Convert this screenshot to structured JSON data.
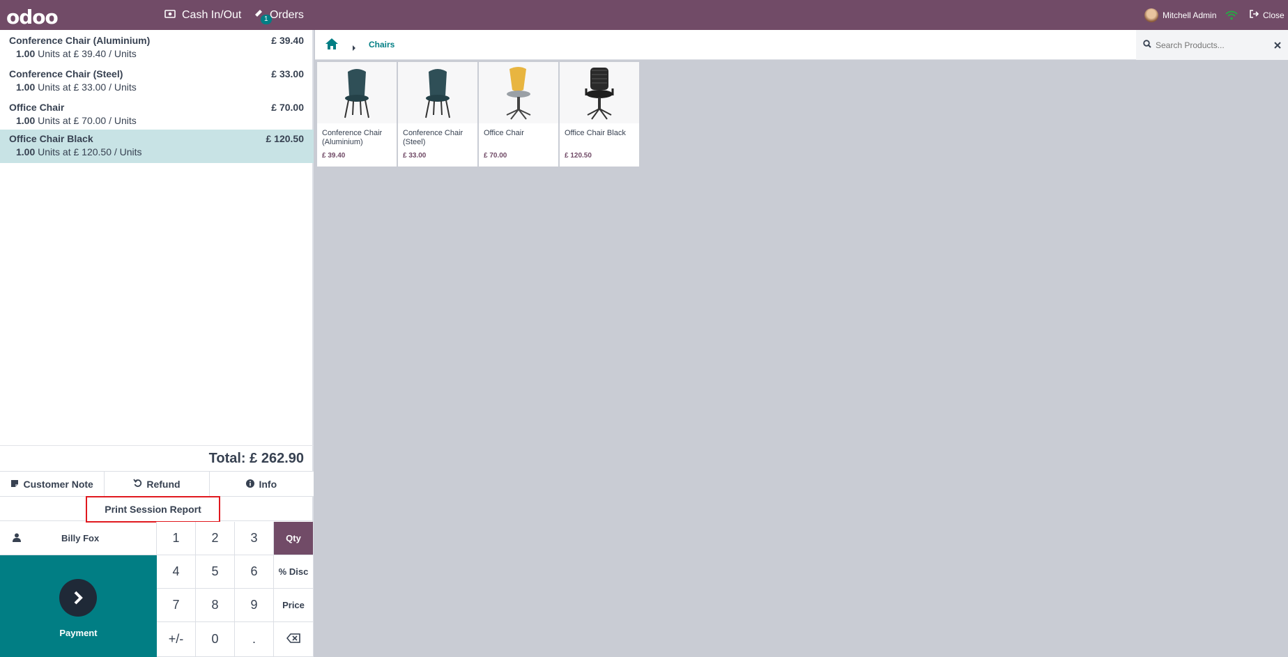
{
  "topbar": {
    "logo": "odoo",
    "cash_label": "Cash In/Out",
    "orders_label": "Orders",
    "orders_badge": "1",
    "user_name": "Mitchell Admin",
    "close_label": "Close",
    "colors": {
      "bar": "#714b67",
      "wifi": "#28a745"
    }
  },
  "order": {
    "lines": [
      {
        "name": "Conference Chair (Aluminium)",
        "price": "£ 39.40",
        "qty": "1.00",
        "info": "Units at £ 39.40 / Units",
        "selected": false
      },
      {
        "name": "Conference Chair (Steel)",
        "price": "£ 33.00",
        "qty": "1.00",
        "info": "Units at £ 33.00 / Units",
        "selected": false
      },
      {
        "name": "Office Chair",
        "price": "£ 70.00",
        "qty": "1.00",
        "info": "Units at £ 70.00 / Units",
        "selected": false
      },
      {
        "name": "Office Chair Black",
        "price": "£ 120.50",
        "qty": "1.00",
        "info": "Units at £ 120.50 / Units",
        "selected": true
      }
    ],
    "total": "Total: £ 262.90"
  },
  "controls": {
    "customer_note": "Customer Note",
    "refund": "Refund",
    "info": "Info",
    "print_session_report": "Print Session Report"
  },
  "keypad": {
    "customer": "Billy Fox",
    "payment": "Payment",
    "keys": [
      "1",
      "2",
      "3",
      "4",
      "5",
      "6",
      "7",
      "8",
      "9",
      "+/-",
      "0",
      "."
    ],
    "modes": [
      "Qty",
      "% Disc",
      "Price"
    ],
    "active_mode": "Qty"
  },
  "catalog": {
    "breadcrumb": "Chairs",
    "search_placeholder": "Search Products...",
    "products": [
      {
        "name": "Conference Chair (Aluminium)",
        "price": "£ 39.40",
        "icon": "teal-chair"
      },
      {
        "name": "Conference Chair (Steel)",
        "price": "£ 33.00",
        "icon": "teal-chair"
      },
      {
        "name": "Office Chair",
        "price": "£ 70.00",
        "icon": "yellow-office-chair"
      },
      {
        "name": "Office Chair Black",
        "price": "£ 120.50",
        "icon": "black-office-chair"
      }
    ]
  }
}
